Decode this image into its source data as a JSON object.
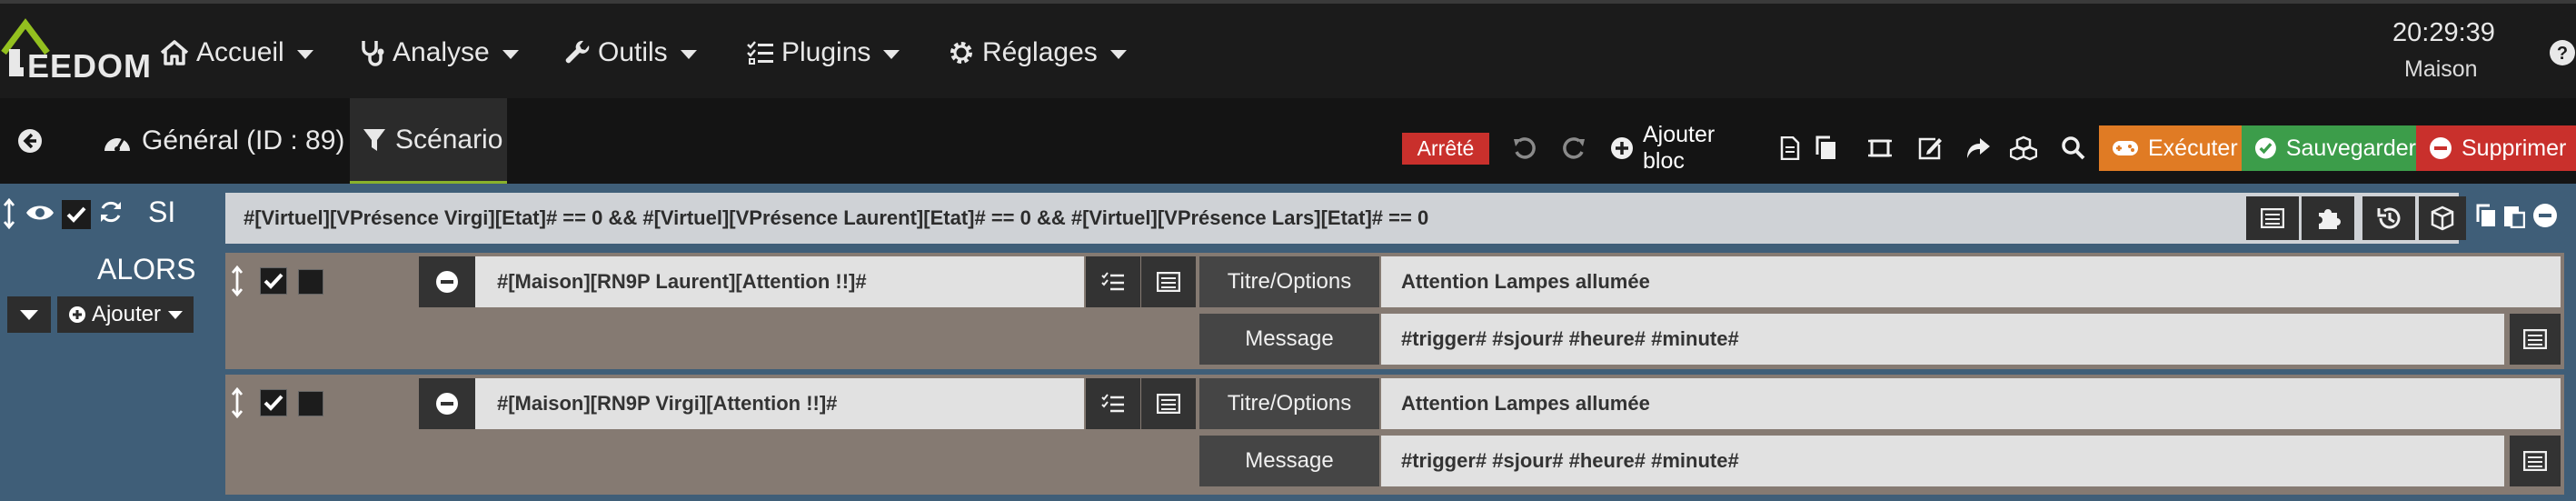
{
  "navbar": {
    "logo_text": "EEDOM",
    "menus": [
      {
        "label": "Accueil",
        "icon": "home-icon"
      },
      {
        "label": "Analyse",
        "icon": "stethoscope-icon"
      },
      {
        "label": "Outils",
        "icon": "wrench-icon"
      },
      {
        "label": "Plugins",
        "icon": "tasks-icon"
      },
      {
        "label": "Réglages",
        "icon": "gear-icon"
      }
    ],
    "time": "20:29:39",
    "location": "Maison"
  },
  "tabs": {
    "general": "Général (ID : 89)",
    "scenario": "Scénario"
  },
  "toolbar": {
    "status": "Arrêté",
    "add_block": "Ajouter bloc",
    "execute": "Exécuter",
    "save": "Sauvegarder",
    "delete": "Supprimer"
  },
  "colors": {
    "status_red": "#c9302c",
    "execute_orange": "#e07b24",
    "save_green": "#3c9d4a",
    "delete_red": "#c9302c",
    "scenario_blue": "#3f5e78",
    "action_brown": "#857a72"
  },
  "scenario": {
    "si_label": "SI",
    "alors_label": "ALORS",
    "add_label": "Ajouter",
    "condition": "#[Virtuel][VPrésence Virgi][Etat]#  == 0  &&  #[Virtuel][VPrésence Laurent][Etat]#  == 0  &&  #[Virtuel][VPrésence Lars][Etat]# == 0",
    "actions": [
      {
        "command": "#[Maison][RN9P Laurent][Attention !!]#",
        "title_label": "Titre/Options",
        "title_value": "Attention Lampes allumée",
        "message_label": "Message",
        "message_value": "#trigger# #sjour# #heure# #minute#"
      },
      {
        "command": "#[Maison][RN9P Virgi][Attention !!]#",
        "title_label": "Titre/Options",
        "title_value": "Attention Lampes allumée",
        "message_label": "Message",
        "message_value": "#trigger# #sjour# #heure# #minute#"
      }
    ]
  }
}
